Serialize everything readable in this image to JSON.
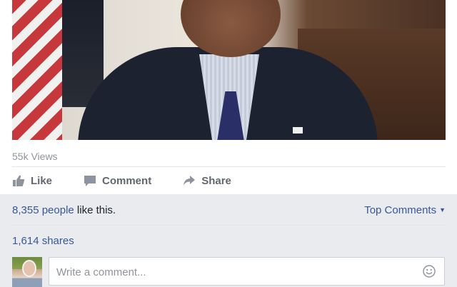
{
  "video": {
    "icon": "video-thumbnail"
  },
  "stats": {
    "views": "55k Views"
  },
  "actions": [
    {
      "label": "Like",
      "icon": "thumbs-up-icon"
    },
    {
      "label": "Comment",
      "icon": "comment-icon"
    },
    {
      "label": "Share",
      "icon": "share-icon"
    }
  ],
  "reactions": {
    "likes_link": "8,355 people",
    "likes_suffix": " like this.",
    "sort_label": "Top Comments",
    "sort_icon": "caret-down-icon",
    "shares": "1,614 shares"
  },
  "composer": {
    "placeholder": "Write a comment...",
    "emoji_icon": "smiley-icon"
  },
  "colors": {
    "link": "#365899",
    "muted": "#90949c",
    "action": "#606770",
    "background": "#e9ebee"
  }
}
